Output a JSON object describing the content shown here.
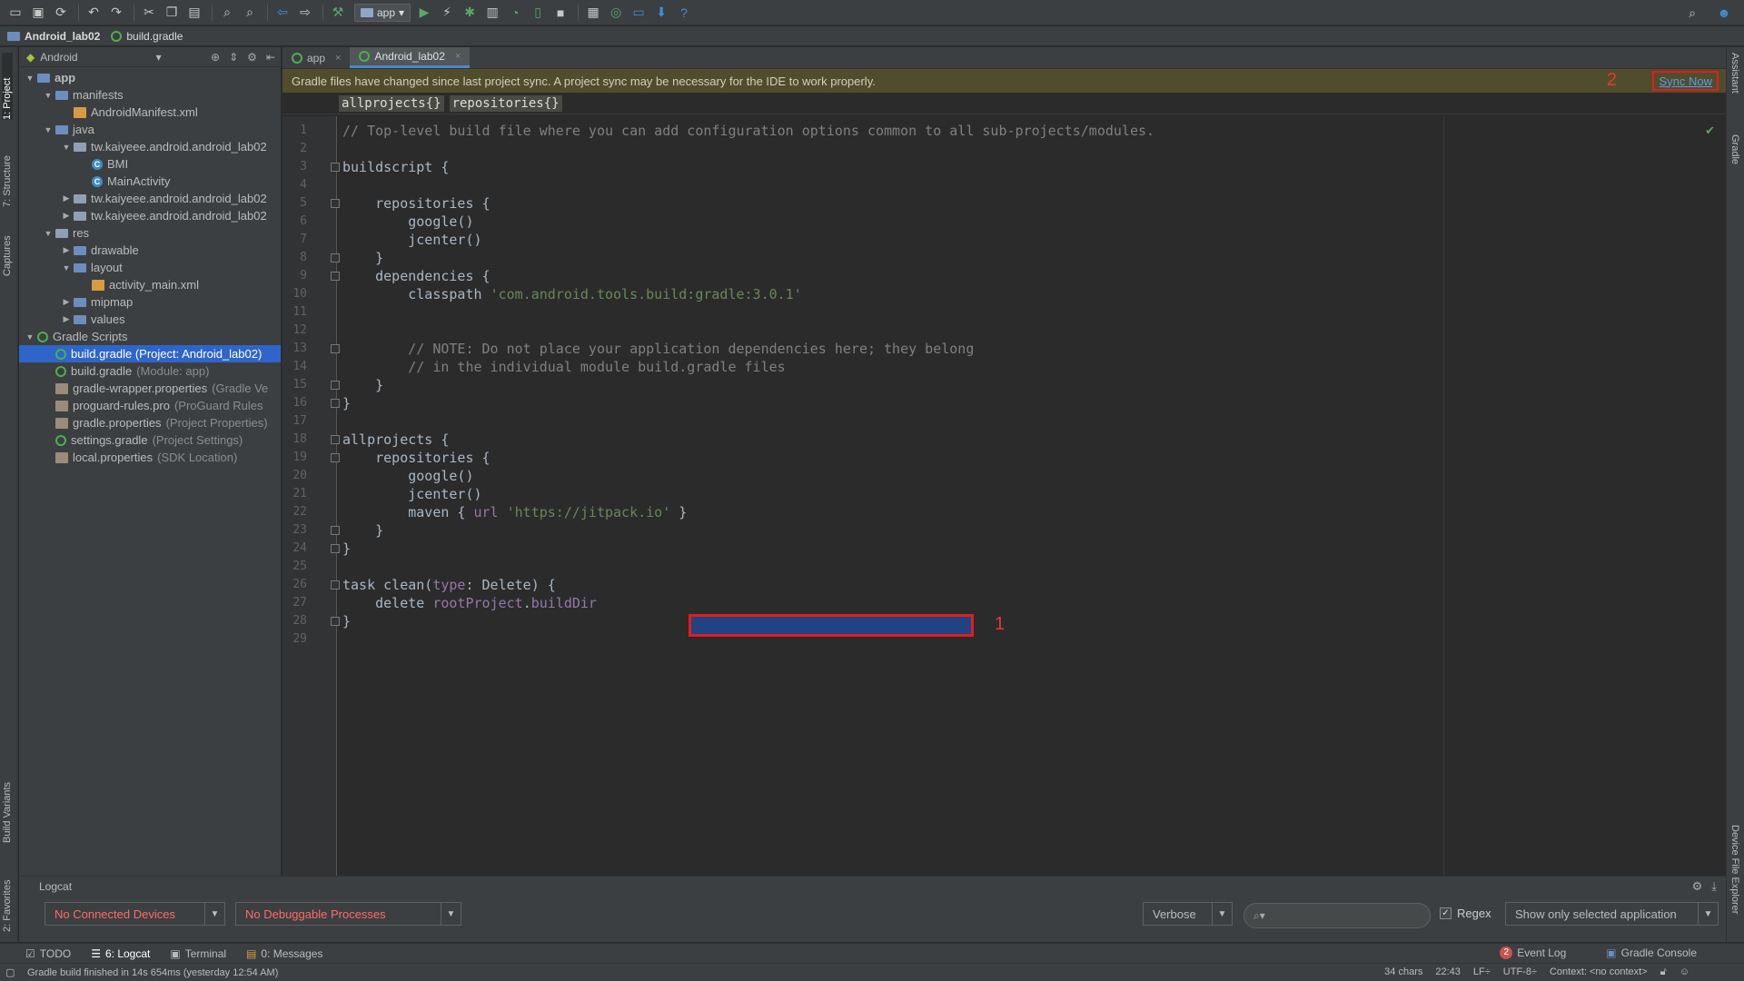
{
  "navbar": {
    "project": "Android_lab02",
    "file": "build.gradle"
  },
  "toolbar": {
    "run_config": "app"
  },
  "left_strip": {
    "project_tab": "1: Project",
    "structure_tab": "7: Structure",
    "captures_tab": "Captures",
    "build_variants_tab": "Build Variants",
    "favorites_tab": "2: Favorites"
  },
  "right_strip": {
    "assistant_tab": "Assistant",
    "gradle_tab": "Gradle",
    "device_explorer_tab": "Device File Explorer"
  },
  "project_panel": {
    "view_selector": "Android",
    "tree": [
      {
        "label": "app",
        "hint": "",
        "depth": 0,
        "arrow": "▼",
        "icon": "folder",
        "bold": true
      },
      {
        "label": "manifests",
        "hint": "",
        "depth": 1,
        "arrow": "▼",
        "icon": "folder"
      },
      {
        "label": "AndroidManifest.xml",
        "hint": "",
        "depth": 2,
        "arrow": "",
        "icon": "xml"
      },
      {
        "label": "java",
        "hint": "",
        "depth": 1,
        "arrow": "▼",
        "icon": "folder"
      },
      {
        "label": "tw.kaiyeee.android.android_lab02",
        "hint": "",
        "depth": 2,
        "arrow": "▼",
        "icon": "package"
      },
      {
        "label": "BMI",
        "hint": "",
        "depth": 3,
        "arrow": "",
        "icon": "class"
      },
      {
        "label": "MainActivity",
        "hint": "",
        "depth": 3,
        "arrow": "",
        "icon": "class"
      },
      {
        "label": "tw.kaiyeee.android.android_lab02",
        "hint": "",
        "depth": 2,
        "arrow": "▶",
        "icon": "package"
      },
      {
        "label": "tw.kaiyeee.android.android_lab02",
        "hint": "",
        "depth": 2,
        "arrow": "▶",
        "icon": "package"
      },
      {
        "label": "res",
        "hint": "",
        "depth": 1,
        "arrow": "▼",
        "icon": "res"
      },
      {
        "label": "drawable",
        "hint": "",
        "depth": 2,
        "arrow": "▶",
        "icon": "folder"
      },
      {
        "label": "layout",
        "hint": "",
        "depth": 2,
        "arrow": "▼",
        "icon": "folder"
      },
      {
        "label": "activity_main.xml",
        "hint": "",
        "depth": 3,
        "arrow": "",
        "icon": "xml"
      },
      {
        "label": "mipmap",
        "hint": "",
        "depth": 2,
        "arrow": "▶",
        "icon": "folder"
      },
      {
        "label": "values",
        "hint": "",
        "depth": 2,
        "arrow": "▶",
        "icon": "folder"
      },
      {
        "label": "Gradle Scripts",
        "hint": "",
        "depth": 0,
        "arrow": "▼",
        "icon": "gradle"
      },
      {
        "label": "build.gradle (Project: Android_lab02)",
        "hint": "",
        "depth": 1,
        "arrow": "",
        "icon": "gradle",
        "selected": true
      },
      {
        "label": "build.gradle",
        "hint": "(Module: app)",
        "depth": 1,
        "arrow": "",
        "icon": "gradle"
      },
      {
        "label": "gradle-wrapper.properties",
        "hint": "(Gradle Ve",
        "depth": 1,
        "arrow": "",
        "icon": "props"
      },
      {
        "label": "proguard-rules.pro",
        "hint": "(ProGuard Rules",
        "depth": 1,
        "arrow": "",
        "icon": "props"
      },
      {
        "label": "gradle.properties",
        "hint": "(Project Properties)",
        "depth": 1,
        "arrow": "",
        "icon": "props"
      },
      {
        "label": "settings.gradle",
        "hint": "(Project Settings)",
        "depth": 1,
        "arrow": "",
        "icon": "gradle"
      },
      {
        "label": "local.properties",
        "hint": "(SDK Location)",
        "depth": 1,
        "arrow": "",
        "icon": "props"
      }
    ]
  },
  "editor": {
    "tabs": [
      {
        "label": "app",
        "active": false
      },
      {
        "label": "Android_lab02",
        "active": true
      }
    ],
    "banner": {
      "message": "Gradle files have changed since last project sync. A project sync may be necessary for the IDE to work properly.",
      "annotation": "2",
      "sync_label": "Sync Now"
    },
    "breadcrumbs": [
      "allprojects{}",
      "repositories{}"
    ],
    "selection_annotation": "1",
    "lines": [
      [
        {
          "t": "// Top-level build file where you can add configuration options common to all sub-projects/modules.",
          "c": "com"
        }
      ],
      [],
      [
        {
          "t": "buildscript {",
          "c": ""
        }
      ],
      [],
      [
        {
          "t": "    repositories {",
          "c": ""
        }
      ],
      [
        {
          "t": "        google()",
          "c": ""
        }
      ],
      [
        {
          "t": "        jcenter()",
          "c": ""
        }
      ],
      [
        {
          "t": "    }",
          "c": ""
        }
      ],
      [
        {
          "t": "    dependencies {",
          "c": ""
        }
      ],
      [
        {
          "t": "        classpath ",
          "c": ""
        },
        {
          "t": "'com.android.tools.build:gradle:3.0.1'",
          "c": "str"
        }
      ],
      [],
      [],
      [
        {
          "t": "        // NOTE: Do not place your application dependencies here; they belong",
          "c": "com"
        }
      ],
      [
        {
          "t": "        // in the individual module build.gradle files",
          "c": "com"
        }
      ],
      [
        {
          "t": "    }",
          "c": ""
        }
      ],
      [
        {
          "t": "}",
          "c": ""
        }
      ],
      [],
      [
        {
          "t": "allprojects {",
          "c": ""
        }
      ],
      [
        {
          "t": "    repositories {",
          "c": ""
        }
      ],
      [
        {
          "t": "        google()",
          "c": ""
        }
      ],
      [
        {
          "t": "        jcenter()",
          "c": ""
        }
      ],
      [
        {
          "t": "        maven { ",
          "c": ""
        },
        {
          "t": "url ",
          "c": "prop"
        },
        {
          "t": "'https://jitpack.io'",
          "c": "str"
        },
        {
          "t": " }",
          "c": ""
        }
      ],
      [
        {
          "t": "    }",
          "c": ""
        }
      ],
      [
        {
          "t": "}",
          "c": ""
        }
      ],
      [],
      [
        {
          "t": "task clean(",
          "c": ""
        },
        {
          "t": "type",
          "c": "prop"
        },
        {
          "t": ": Delete) {",
          "c": ""
        }
      ],
      [
        {
          "t": "    delete ",
          "c": ""
        },
        {
          "t": "rootProject",
          "c": "prop"
        },
        {
          "t": ".",
          "c": ""
        },
        {
          "t": "buildDir",
          "c": "prop"
        }
      ],
      [
        {
          "t": "}",
          "c": ""
        }
      ],
      []
    ]
  },
  "logcat": {
    "title": "Logcat",
    "device": "No Connected Devices",
    "process": "No Debuggable Processes",
    "level": "Verbose",
    "search_placeholder": "",
    "regex_label": "Regex",
    "regex_checked": true,
    "filter": "Show only selected application"
  },
  "bottom_tabs": {
    "left": [
      {
        "label": "TODO",
        "active": false
      },
      {
        "label": "6: Logcat",
        "active": true
      },
      {
        "label": "Terminal",
        "active": false
      },
      {
        "label": "0: Messages",
        "active": false
      }
    ],
    "event_log": "Event Log",
    "event_count": "2",
    "gradle_console": "Gradle Console"
  },
  "status": {
    "message": "Gradle build finished in 14s 654ms (yesterday 12:54 AM)",
    "chars": "34 chars",
    "position": "22:43",
    "line_sep": "LF÷",
    "encoding": "UTF-8÷",
    "context": "Context: <no context>"
  },
  "colors": {
    "accent": "#4a88c7",
    "banner": "#514d2c",
    "annotation_red": "#e01d1d",
    "selection": "#214283"
  }
}
